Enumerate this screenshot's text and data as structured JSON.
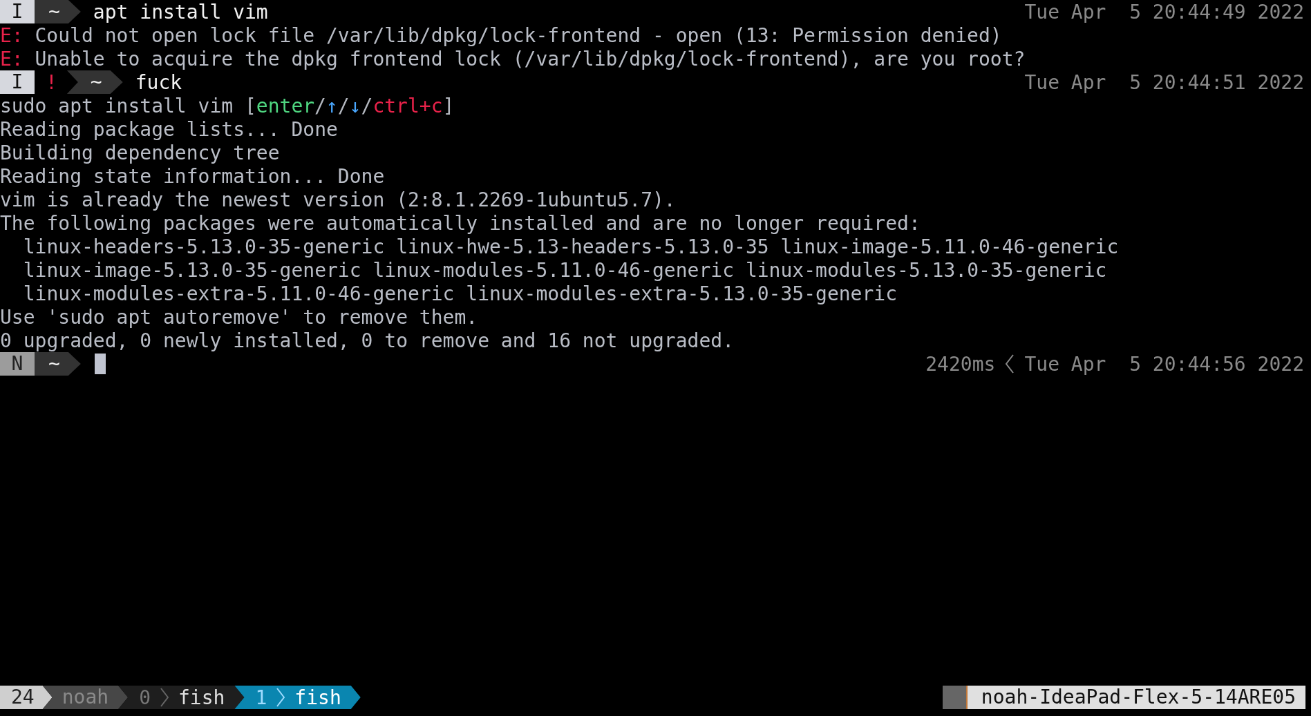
{
  "lines": [
    {
      "kind": "prompt",
      "mode": {
        "label": "I",
        "kind": "insert"
      },
      "dir": "~",
      "command": "apt install vim",
      "time": "Tue Apr  5 20:44:49 2022"
    },
    {
      "kind": "error",
      "prefix": "E:",
      "text": "Could not open lock file /var/lib/dpkg/lock-frontend - open (13: Permission denied)"
    },
    {
      "kind": "error",
      "prefix": "E:",
      "text": "Unable to acquire the dpkg frontend lock (/var/lib/dpkg/lock-frontend), are you root?"
    },
    {
      "kind": "prompt",
      "mode": {
        "label": "I",
        "kind": "insert"
      },
      "status": "!",
      "dir": "~",
      "command": "fuck",
      "time": "Tue Apr  5 20:44:51 2022"
    },
    {
      "kind": "suggestion",
      "command": "sudo apt install vim",
      "hint": [
        {
          "text": "[",
          "color": "#b4b8c0"
        },
        {
          "text": "enter",
          "color": "#4fd680"
        },
        {
          "text": "/",
          "color": "#b4b8c0"
        },
        {
          "text": "↑",
          "color": "#4aa8ff"
        },
        {
          "text": "/",
          "color": "#b4b8c0"
        },
        {
          "text": "↓",
          "color": "#4aa8ff"
        },
        {
          "text": "/",
          "color": "#b4b8c0"
        },
        {
          "text": "ctrl+c",
          "color": "#e8224a"
        },
        {
          "text": "]",
          "color": "#b4b8c0"
        }
      ]
    },
    {
      "kind": "output",
      "text": "Reading package lists... Done"
    },
    {
      "kind": "output",
      "text": "Building dependency tree"
    },
    {
      "kind": "output",
      "text": "Reading state information... Done"
    },
    {
      "kind": "output",
      "text": "vim is already the newest version (2:8.1.2269-1ubuntu5.7)."
    },
    {
      "kind": "output",
      "text": "The following packages were automatically installed and are no longer required:"
    },
    {
      "kind": "output",
      "text": "  linux-headers-5.13.0-35-generic linux-hwe-5.13-headers-5.13.0-35 linux-image-5.11.0-46-generic"
    },
    {
      "kind": "output",
      "text": "  linux-image-5.13.0-35-generic linux-modules-5.11.0-46-generic linux-modules-5.13.0-35-generic"
    },
    {
      "kind": "output",
      "text": "  linux-modules-extra-5.11.0-46-generic linux-modules-extra-5.13.0-35-generic"
    },
    {
      "kind": "output",
      "text": "Use 'sudo apt autoremove' to remove them."
    },
    {
      "kind": "output",
      "text": "0 upgraded, 0 newly installed, 0 to remove and 16 not upgraded."
    },
    {
      "kind": "prompt",
      "mode": {
        "label": "N",
        "kind": "normal"
      },
      "dir": "~",
      "cursor": true,
      "duration": "2420ms",
      "time": "Tue Apr  5 20:44:56 2022"
    }
  ],
  "status_bar": {
    "session": "24",
    "user": "noah",
    "windows": [
      {
        "index": "0",
        "name": "fish",
        "selected": false
      },
      {
        "index": "1",
        "name": "fish",
        "selected": true
      }
    ],
    "host": "noah-IdeaPad-Flex-5-14ARE05"
  }
}
